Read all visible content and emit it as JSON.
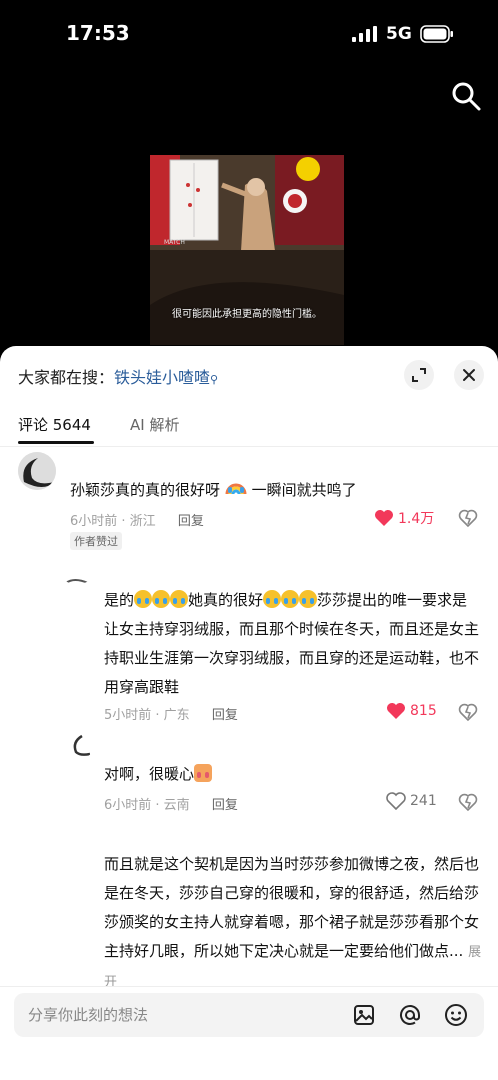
{
  "status": {
    "time": "17:53",
    "network": "5G"
  },
  "video": {
    "subtitle": "很可能因此承担更高的隐性门槛。",
    "logo_text": "MATCH"
  },
  "panel": {
    "search_prefix": "大家都在搜：",
    "search_keyword": "铁头娃小喳喳",
    "tabs": [
      {
        "label": "评论 5644"
      },
      {
        "label": "AI 解析"
      }
    ]
  },
  "comments": [
    {
      "text": "孙颖莎真的真的很好呀",
      "text_after": "一瞬间就共鸣了",
      "time": "6小时前 · 浙江",
      "reply": "回复",
      "likes": "1.4万",
      "tag": "作者赞过"
    },
    {
      "text_1": "是的",
      "text_2": "她真的很好",
      "text_3": "莎莎提出的唯一要求是让女主持穿羽绒服，而且那个时候在冬天，而且还是女主持职业生涯第一次穿羽绒服，而且穿的还是运动鞋，也不用穿高跟鞋",
      "time": "5小时前 · 广东",
      "reply": "回复",
      "likes": "815"
    },
    {
      "text": "对啊，很暖心",
      "time": "6小时前 · 云南",
      "reply": "回复",
      "likes": "241"
    },
    {
      "text": "而且就是这个契机是因为当时莎莎参加微博之夜，然后也是在冬天，莎莎自己穿的很暖和，穿的很舒适，然后给莎莎颁奖的女主持人就穿着嗯，那个裙子就是莎莎看那个女主持好几眼，所以她下定决心就是一定要给他们做点...",
      "expand": "展开"
    }
  ],
  "input": {
    "placeholder": "分享你此刻的想法"
  },
  "colors": {
    "like_red": "#f2385a",
    "keyword_blue": "#2b5d9a"
  },
  "icons": [
    "signal-icon",
    "battery-icon",
    "search-icon",
    "expand-icon",
    "close-icon",
    "heart-icon",
    "dislike-icon",
    "image-icon",
    "at-icon",
    "emoji-icon"
  ]
}
